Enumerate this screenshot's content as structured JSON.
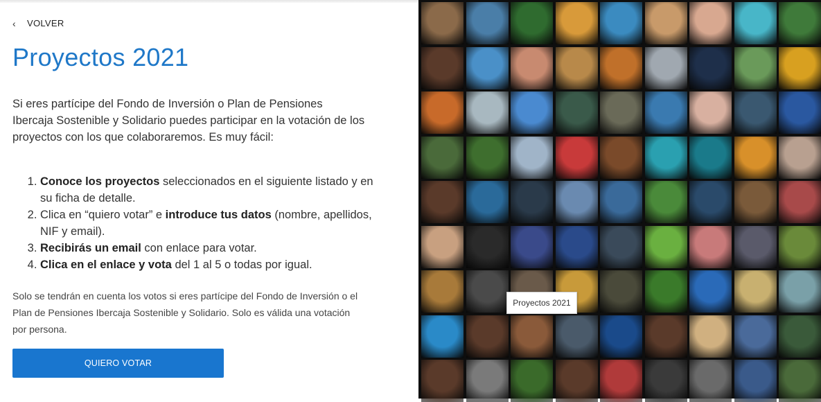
{
  "nav": {
    "back_label": "VOLVER"
  },
  "page": {
    "title": "Proyectos 2021",
    "intro": "Si eres partícipe del Fondo de Inversión o Plan de Pensiones Ibercaja Sostenible y Solidario puedes participar en la votación de los proyectos con los que colaboraremos. Es muy fácil:",
    "steps": [
      {
        "bold": "Conoce los proyectos",
        "rest": " seleccionados en el siguiente listado y en su ficha de detalle."
      },
      {
        "pre": "Clica en “quiero votar” e ",
        "bold": "introduce tus datos",
        "rest": " (nombre, apellidos, NIF y email)."
      },
      {
        "bold": "Recibirás un email",
        "rest": " con enlace para votar."
      },
      {
        "bold": "Clica en el enlace y vota",
        "rest": " del 1 al 5 o todas por igual."
      }
    ],
    "note": "Solo se tendrán en cuenta los votos si eres partícipe del Fondo de Inversión o el Plan de Pensiones Ibercaja Sostenible y Solidario. Solo es válida una votación por persona.",
    "cta_label": "QUIERO VOTAR"
  },
  "image": {
    "tooltip": "Proyectos 2021",
    "tile_colors": [
      "#8b6a4a",
      "#4a7ea8",
      "#2f6b2f",
      "#d89a3a",
      "#3b8bc0",
      "#c89a6a",
      "#d8a890",
      "#48b6c8",
      "#3f7a3a",
      "#5a3a2a",
      "#4a90c8",
      "#c88a70",
      "#b8894a",
      "#c0702a",
      "#a0a8b0",
      "#1e2f4a",
      "#6a9a5a",
      "#d8a020",
      "#c86a2a",
      "#a8b8c0",
      "#4a8ad0",
      "#3a5a4a",
      "#6a6a58",
      "#3a7ab0",
      "#d8b0a0",
      "#3a5870",
      "#2a58a0",
      "#4a6a3a",
      "#3e6e2e",
      "#a0b4c8",
      "#c83a3a",
      "#7a4a2a",
      "#2aa0b0",
      "#1a7a8a",
      "#d8902a",
      "#b8a090",
      "#5a3a2a",
      "#2a6a9a",
      "#2a3a4a",
      "#6a8ab0",
      "#3a6a9a",
      "#4a8a3a",
      "#2a4a6a",
      "#7a5a3a",
      "#a84a4a",
      "#c8a080",
      "#2a2a2a",
      "#3a4a8a",
      "#2a4a8a",
      "#3a4a5a",
      "#6ab040",
      "#c87a7a",
      "#5a5a6a",
      "#6a8a3a",
      "#a87a3a",
      "#4a4a4a",
      "#6a5a4a",
      "#c89a3a",
      "#4a4a3a",
      "#3a7a2a",
      "#2a6ab8",
      "#c8b070",
      "#7aa0a8",
      "#2a8ac8",
      "#5a3a2a",
      "#8a5a3a",
      "#4a5a6a",
      "#1a4a8a",
      "#5a3a2a",
      "#d0b080",
      "#4a6a9a",
      "#3a5a3a",
      "#5a3a2a",
      "#7a7a7a",
      "#3a6a2a",
      "#5a3a2a",
      "#b03a3a",
      "#3a3a3a",
      "#6a6a6a",
      "#3a5a8a",
      "#4a6a3a"
    ]
  }
}
